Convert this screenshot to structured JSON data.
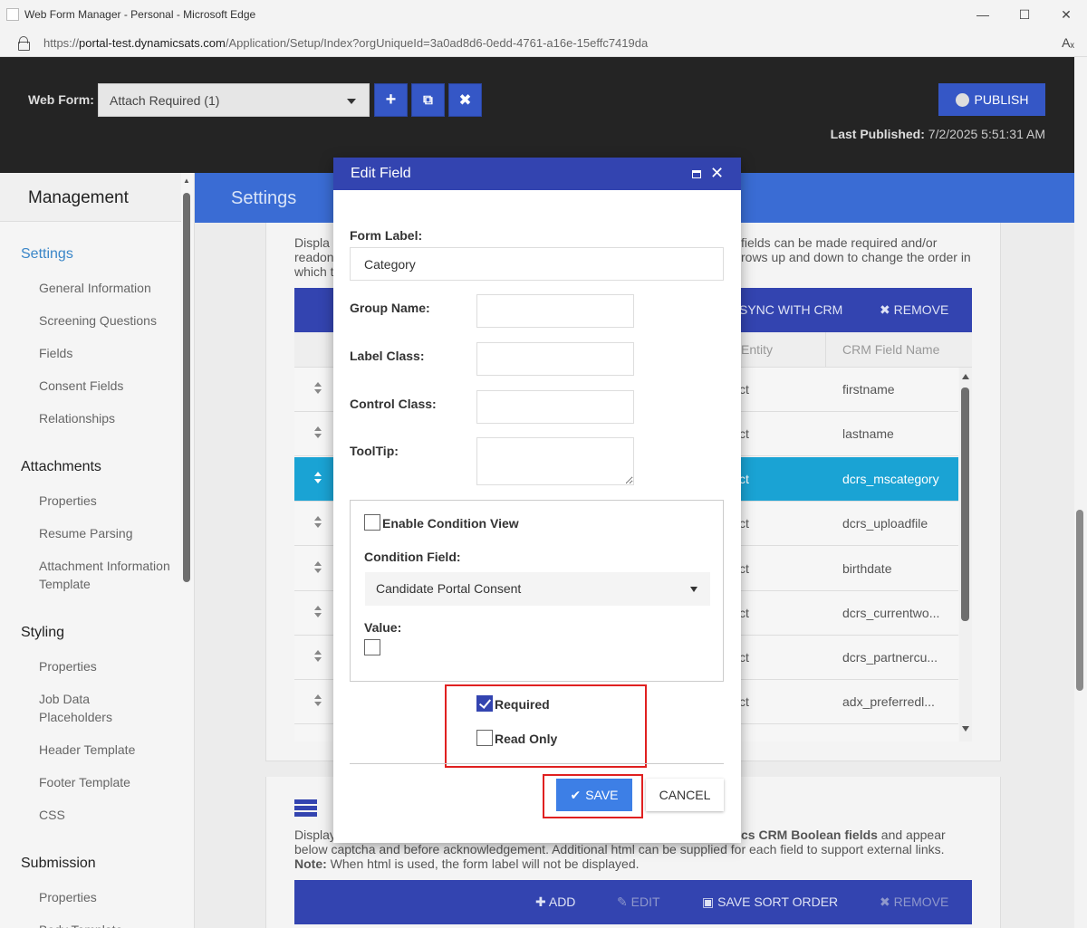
{
  "browser": {
    "window_title": "Web Form Manager - Personal - Microsoft Edge",
    "url_prefix": "https://",
    "url_host": "portal-test.dynamicsats.com",
    "url_path": "/Application/Setup/Index?orgUniqueId=3a0ad8d6-0edd-4761-a16e-15effc7419da"
  },
  "header": {
    "web_form_label": "Web Form:",
    "web_form_value": "Attach Required (1)",
    "publish_label": "PUBLISH",
    "last_published_label": "Last Published:",
    "last_published_value": "7/2/2025 5:51:31 AM"
  },
  "sidebar": {
    "title": "Management",
    "sections": [
      {
        "label": "Settings",
        "items": [
          "General Information",
          "Screening Questions",
          "Fields",
          "Consent Fields",
          "Relationships"
        ]
      },
      {
        "label": "Attachments",
        "items": [
          "Properties",
          "Resume Parsing",
          "Attachment Information Template"
        ]
      },
      {
        "label": "Styling",
        "items": [
          "Properties",
          "Job Data Placeholders",
          "Header Template",
          "Footer Template",
          "CSS"
        ]
      },
      {
        "label": "Submission",
        "items": [
          "Properties",
          "Body Template"
        ]
      }
    ]
  },
  "main": {
    "page_title": "Settings",
    "fields_desc_1": "Displa",
    "fields_desc_1b": "fields can be made required and/or",
    "fields_desc_2": "readon",
    "fields_desc_2b": "rows up and down to change the order in",
    "fields_desc_3": "which t",
    "toolbar": {
      "sync": "SYNC WITH CRM",
      "remove": "REMOVE"
    },
    "columns": {
      "entity": "Entity",
      "crm_field": "CRM Field Name"
    },
    "rows": [
      {
        "entity": "ct",
        "field": "firstname"
      },
      {
        "entity": "ct",
        "field": "lastname"
      },
      {
        "entity": "ct",
        "field": "dcrs_mscategory"
      },
      {
        "entity": "ct",
        "field": "dcrs_uploadfile"
      },
      {
        "entity": "ct",
        "field": "birthdate"
      },
      {
        "entity": "ct",
        "field": "dcrs_currentwo..."
      },
      {
        "entity": "ct",
        "field": "dcrs_partnercu..."
      },
      {
        "entity": "ct",
        "field": "adx_preferredl..."
      }
    ],
    "consent_desc_1a": "Display",
    "consent_desc_1b": "cs CRM Boolean fields",
    "consent_desc_1c": " and appear",
    "consent_desc_2": "below captcha and before acknowledgement. Additional html can be supplied for each field to support external links.",
    "consent_note_label": "Note:",
    "consent_note_text": " When html is used, the form label will not be displayed.",
    "toolbar2": {
      "add": "ADD",
      "edit": "EDIT",
      "save_sort": "SAVE SORT ORDER",
      "remove": "REMOVE"
    }
  },
  "dialog": {
    "title": "Edit Field",
    "form_label_label": "Form Label:",
    "form_label_value": "Category",
    "group_name_label": "Group Name:",
    "label_class_label": "Label Class:",
    "control_class_label": "Control Class:",
    "tooltip_label": "ToolTip:",
    "enable_condition_label": "Enable Condition View",
    "condition_field_label": "Condition Field:",
    "condition_field_value": "Candidate Portal Consent",
    "value_label": "Value:",
    "required_label": "Required",
    "readonly_label": "Read Only",
    "save_label": "SAVE",
    "cancel_label": "CANCEL"
  }
}
